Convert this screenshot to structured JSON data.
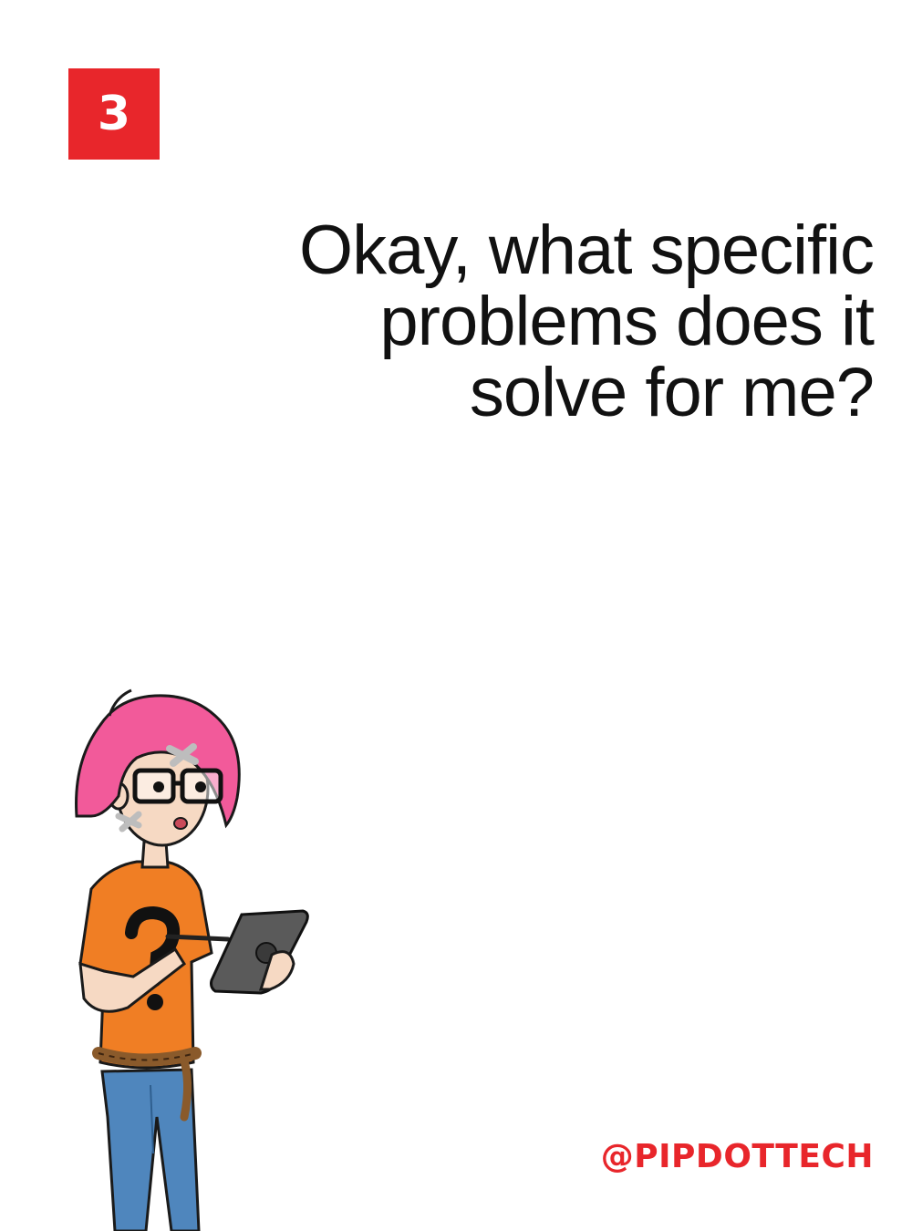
{
  "slide": {
    "number": "3",
    "question": "Okay, what specific problems does it solve for me?",
    "handle": "@PIPDOTTECH"
  },
  "colors": {
    "accent": "#e8262b",
    "text": "#111111",
    "background": "#ffffff",
    "hair": "#f25a9a",
    "shirt": "#f07e24",
    "jeans": "#4f86bd",
    "rope": "#8a5a2b",
    "tablet": "#5a5a5a",
    "skin": "#f6d9c3"
  },
  "illustration": {
    "subject": "pink-haired-person-with-tablet",
    "icons": [
      "bandage-icon",
      "question-mark-icon",
      "tablet-icon",
      "stylus-icon",
      "glasses-icon"
    ]
  }
}
